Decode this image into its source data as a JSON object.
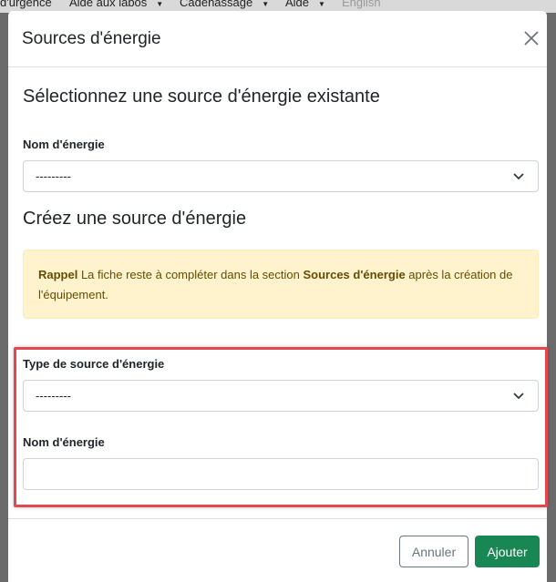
{
  "background_nav": {
    "items": [
      {
        "label": "d'urgence"
      },
      {
        "label": "Aide aux labos"
      },
      {
        "label": "Cadenassage"
      },
      {
        "label": "Aide"
      },
      {
        "label": "English"
      }
    ]
  },
  "modal": {
    "title": "Sources d'énergie",
    "existing_section": {
      "heading": "Sélectionnez une source d'énergie existante",
      "name_label": "Nom d'énergie",
      "name_select_value": "---------"
    },
    "create_section": {
      "heading": "Créez une source d'énergie",
      "alert": {
        "bold_prefix": "Rappel",
        "text_before": " La fiche reste à compléter dans la section ",
        "bold_link": "Sources d'énergie",
        "text_after": " après la création de l'équipement."
      },
      "type_label": "Type de source d'énergie",
      "type_select_value": "---------",
      "name_label": "Nom d'énergie",
      "name_input_value": ""
    },
    "footer": {
      "cancel_label": "Annuler",
      "add_label": "Ajouter"
    }
  },
  "colors": {
    "primary_green": "#198754",
    "alert_bg": "#fff3cd",
    "alert_text": "#664d03",
    "highlight_red": "#e3474f"
  },
  "icons": {
    "close": "close-icon",
    "select_chevron": "chevron-down-icon"
  }
}
